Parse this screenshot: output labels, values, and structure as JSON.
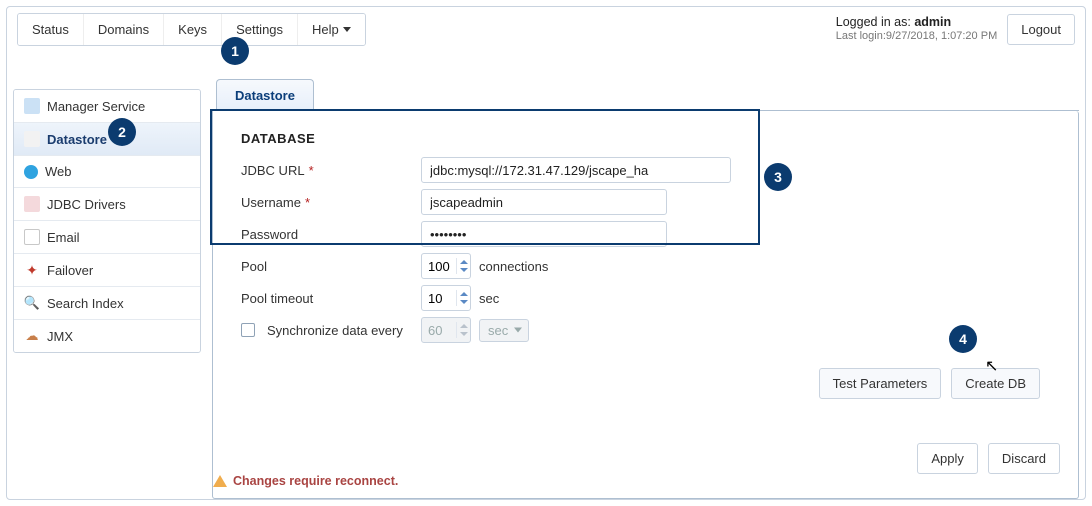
{
  "nav": {
    "items": [
      "Status",
      "Domains",
      "Keys",
      "Settings",
      "Help"
    ]
  },
  "header": {
    "logged_in_label": "Logged in as:",
    "logged_in_user": "admin",
    "last_login_label": "Last login:",
    "last_login_value": "9/27/2018, 1:07:20 PM",
    "logout": "Logout"
  },
  "sidebar": {
    "items": [
      {
        "label": "Manager Service"
      },
      {
        "label": "Datastore"
      },
      {
        "label": "Web"
      },
      {
        "label": "JDBC Drivers"
      },
      {
        "label": "Email"
      },
      {
        "label": "Failover"
      },
      {
        "label": "Search Index"
      },
      {
        "label": "JMX"
      }
    ]
  },
  "tabs": {
    "datastore": "Datastore"
  },
  "form": {
    "section_title": "DATABASE",
    "labels": {
      "jdbc_url": "JDBC URL",
      "username": "Username",
      "password": "Password",
      "pool": "Pool",
      "pool_timeout": "Pool timeout",
      "sync": "Synchronize data every"
    },
    "values": {
      "jdbc_url": "jdbc:mysql://172.31.47.129/jscape_ha",
      "username": "jscapeadmin",
      "password": "••••••••",
      "pool": "100",
      "pool_timeout": "10",
      "sync_every": "60"
    },
    "units": {
      "pool": "connections",
      "pool_timeout": "sec",
      "sync": "sec"
    },
    "buttons": {
      "test": "Test Parameters",
      "create": "Create DB",
      "apply": "Apply",
      "discard": "Discard"
    }
  },
  "warning": "Changes require reconnect.",
  "annotations": {
    "b1": "1",
    "b2": "2",
    "b3": "3",
    "b4": "4"
  }
}
